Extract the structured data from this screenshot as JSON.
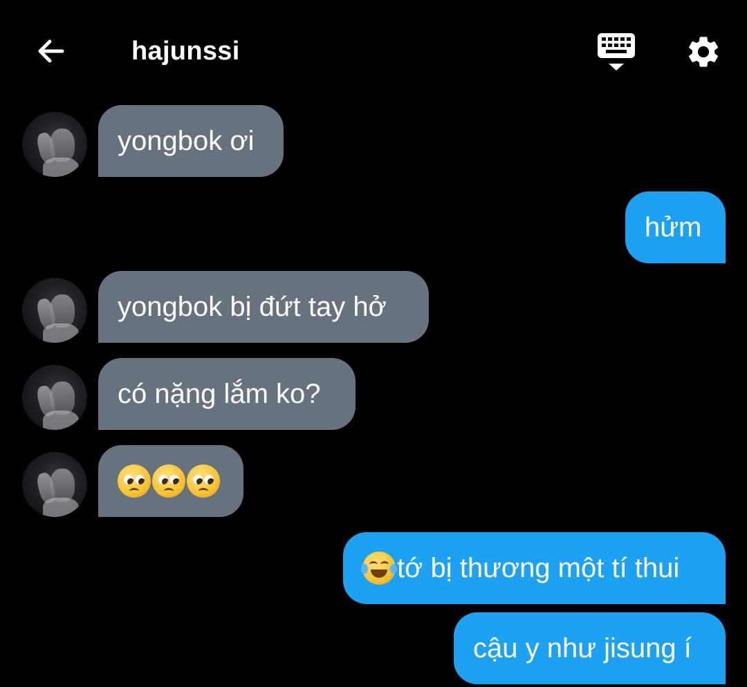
{
  "header": {
    "title": "hajunssi",
    "back_icon": "arrow-left-icon",
    "keyboard_icon": "keyboard-icon",
    "settings_icon": "gear-icon"
  },
  "colors": {
    "background": "#000000",
    "incoming_bubble": "#66737f",
    "outgoing_bubble": "#1da1f2",
    "text": "#ffffff"
  },
  "messages": [
    {
      "direction": "incoming",
      "text": "yongbok ơi"
    },
    {
      "direction": "outgoing",
      "text": "hửm"
    },
    {
      "direction": "incoming",
      "text": "yongbok bị đứt tay hở"
    },
    {
      "direction": "incoming",
      "text": "có nặng lắm ko?"
    },
    {
      "direction": "incoming",
      "emoji": [
        "pleading-face",
        "pleading-face",
        "pleading-face"
      ]
    },
    {
      "direction": "outgoing",
      "emoji": "face-with-tears-of-joy",
      "text": "tớ bị thương một tí thui"
    },
    {
      "direction": "outgoing",
      "text": "cậu y như jisung í"
    }
  ]
}
